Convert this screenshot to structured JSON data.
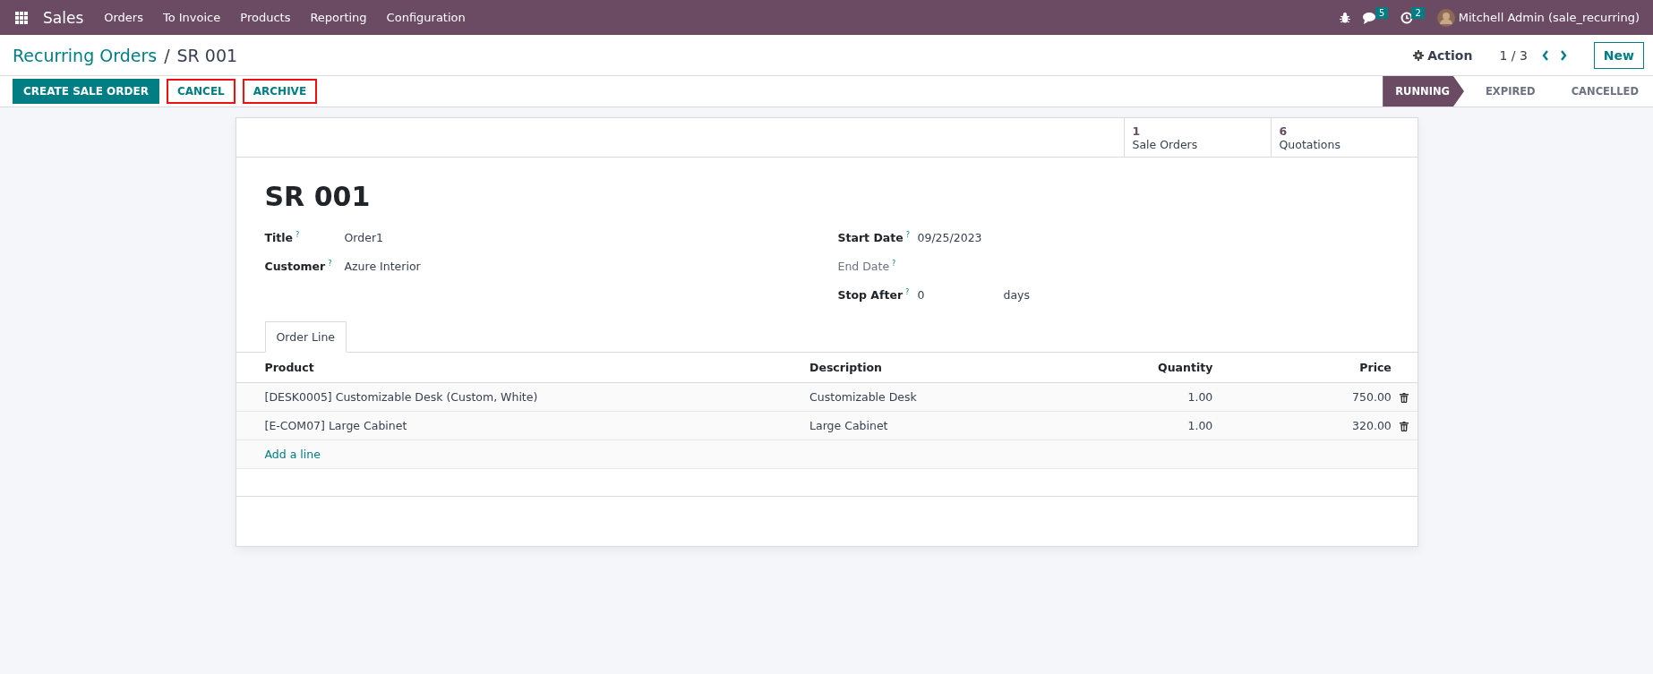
{
  "navbar": {
    "app": "Sales",
    "menu": [
      "Orders",
      "To Invoice",
      "Products",
      "Reporting",
      "Configuration"
    ],
    "chat_count": "5",
    "activity_count": "2",
    "user": "Mitchell Admin (sale_recurring)"
  },
  "breadcrumb": {
    "parent": "Recurring Orders",
    "separator": "/",
    "current": "SR 001"
  },
  "control": {
    "action": "Action",
    "pager": "1 / 3",
    "new": "New"
  },
  "buttons": [
    {
      "label": "CREATE SALE ORDER",
      "kind": "primary",
      "highlighted": false
    },
    {
      "label": "CANCEL",
      "kind": "secondary",
      "highlighted": true
    },
    {
      "label": "ARCHIVE",
      "kind": "secondary",
      "highlighted": true
    }
  ],
  "stages": [
    {
      "label": "RUNNING",
      "selected": true
    },
    {
      "label": "EXPIRED",
      "selected": false
    },
    {
      "label": "CANCELLED",
      "selected": false
    }
  ],
  "smart_buttons": [
    {
      "count": "1",
      "label": "Sale Orders"
    },
    {
      "count": "6",
      "label": "Quotations"
    }
  ],
  "record": {
    "name": "SR 001",
    "left_fields": [
      {
        "label": "Title",
        "help": "?",
        "value": "Order1",
        "readonly": false
      },
      {
        "label": "Customer",
        "help": "?",
        "value": "Azure Interior",
        "readonly": false
      }
    ],
    "right_fields": [
      {
        "label": "Start Date",
        "help": "?",
        "value": "09/25/2023",
        "readonly": false
      },
      {
        "label": "End Date",
        "help": "?",
        "readonly": true
      },
      {
        "label": "Stop After",
        "help": "?",
        "value": "0",
        "unit": "days",
        "readonly": false
      }
    ]
  },
  "tabs": [
    {
      "label": "Order Line",
      "selected": true
    }
  ],
  "table": {
    "columns": [
      "Product",
      "Description",
      "Quantity",
      "Price"
    ],
    "rows": [
      {
        "product": "[DESK0005] Customizable Desk (Custom, White)",
        "description": "Customizable Desk",
        "quantity": "1.00",
        "price": "750.00"
      },
      {
        "product": "[E-COM07] Large Cabinet",
        "description": "Large Cabinet",
        "quantity": "1.00",
        "price": "320.00"
      }
    ],
    "add_line": "Add a line"
  }
}
